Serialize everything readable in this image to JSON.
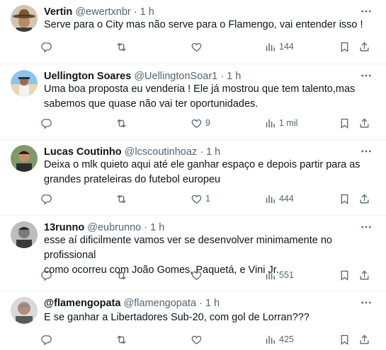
{
  "tweets": [
    {
      "name": "Vertin",
      "handle": "@ewertxnbr",
      "time": "1 h",
      "lines": [
        "Serve para o City mas não serve para o Flamengo, vai entender isso !"
      ],
      "replies": "",
      "reposts": "",
      "likes": "",
      "views": "144",
      "avatar": "avatar-cowboy-hat"
    },
    {
      "name": "Uellington Soares",
      "handle": "@UellingtonSoar1",
      "time": "1 h",
      "lines": [
        "Uma boa proposta eu venderia ! Ele já mostrou que tem talento,mas",
        "sabemos que quase não vai ter oportunidades."
      ],
      "replies": "",
      "reposts": "",
      "likes": "9",
      "views": "1 mil",
      "avatar": "avatar-beach"
    },
    {
      "name": "Lucas Coutinho",
      "handle": "@lcscoutinhoaz",
      "time": "1 h",
      "lines": [
        "Deixa o mlk quieto aqui até ele ganhar espaço e depois partir para as",
        "grandes prateleiras do futebol europeu"
      ],
      "replies": "",
      "reposts": "",
      "likes": "1",
      "views": "444",
      "avatar": "avatar-man"
    },
    {
      "name": "13runno",
      "handle": "@eubrunno",
      "time": "1 h",
      "lines": [
        "esse aí dificilmente vamos ver se desenvolver minimamente no profissional",
        "como ocorreu com João Gomes, Paquetá, e Vini Jr."
      ],
      "replies": "",
      "reposts": "",
      "likes": "",
      "views": "551",
      "avatar": "avatar-bw-photo"
    },
    {
      "name": "@flamengopata",
      "handle": "@flamengopata",
      "time": "1 h",
      "lines": [
        "E se ganhar a Libertadores Sub-20, com gol de Lorran???"
      ],
      "replies": "",
      "reposts": "",
      "likes": "",
      "views": "425",
      "avatar": "avatar-older-man"
    }
  ],
  "separator": "·",
  "icons": [
    "more-icon",
    "reply-icon",
    "repost-icon",
    "like-icon",
    "views-icon",
    "bookmark-icon",
    "share-icon"
  ],
  "colors": {
    "text": "#0f1419",
    "secondary": "#536471",
    "divider": "#eff3f4"
  }
}
